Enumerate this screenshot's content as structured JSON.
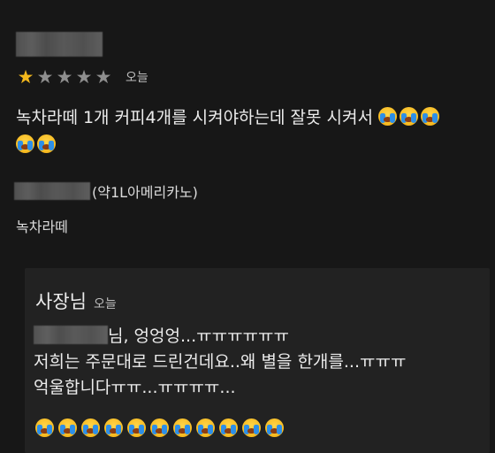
{
  "review": {
    "rating": 1,
    "rating_max": 5,
    "date": "오늘",
    "text": "녹차라떼 1개 커피4개를 시켜야하는데 잘못 시켜서",
    "emoji_icon": "loudly-crying-face-icon"
  },
  "order": {
    "option": "(약1L아메리카노)",
    "item": "녹차라떼"
  },
  "reply": {
    "author": "사장님",
    "date": "오늘",
    "line1_suffix": "님, 엉엉엉...ㅠㅠㅠㅠㅠㅠ",
    "line2": "저희는 주문대로 드린건데요..왜 별을 한개를...ㅠㅠㅠ",
    "line3": "억울합니다ㅠㅠ...ㅠㅠㅠㅠ...",
    "emoji_icon": "loudly-crying-face-icon"
  },
  "colors": {
    "background": "#171717",
    "reply_background": "#222222",
    "star_active": "#f4b81c",
    "star_inactive": "#8e8e8e"
  }
}
